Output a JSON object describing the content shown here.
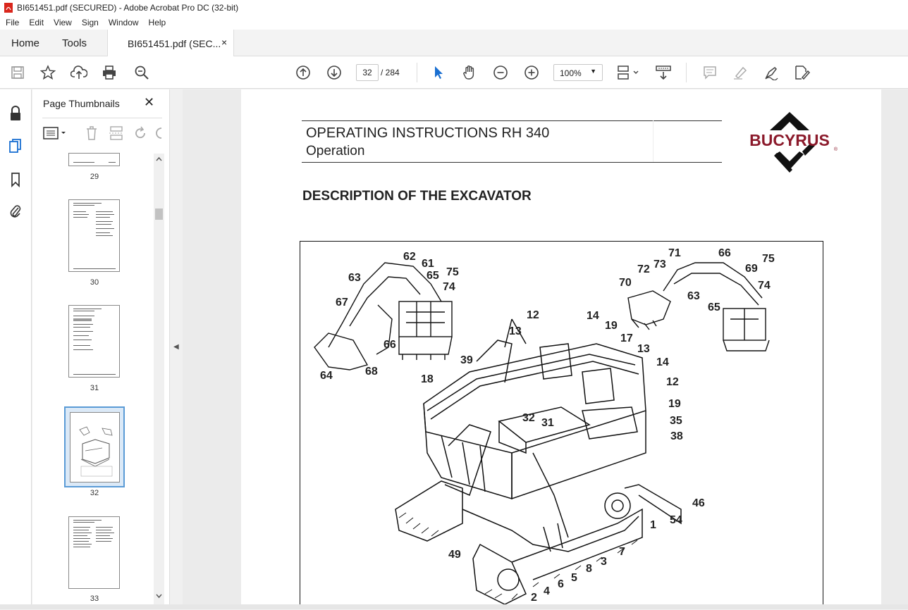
{
  "window": {
    "title": "BI651451.pdf (SECURED) - Adobe Acrobat Pro DC (32-bit)"
  },
  "menu": {
    "items": [
      "File",
      "Edit",
      "View",
      "Sign",
      "Window",
      "Help"
    ]
  },
  "tabs": {
    "home": "Home",
    "tools": "Tools",
    "document": "BI651451.pdf (SEC...",
    "close": "×"
  },
  "toolbar": {
    "current_page": "32",
    "total_pages": "/ 284",
    "zoom": "100%",
    "icons": [
      "save-icon",
      "star-icon",
      "upload-icon",
      "print-icon",
      "zoom-search-icon",
      "page-up-icon",
      "page-down-icon",
      "select-cursor-icon",
      "hand-icon",
      "zoom-out-icon",
      "zoom-in-icon",
      "page-layout-icon",
      "scroll-mode-icon",
      "comment-icon",
      "highlight-icon",
      "sign-icon",
      "fill-sign-icon"
    ]
  },
  "panel": {
    "title": "Page Thumbnails",
    "close": "✕",
    "thumbnails": [
      {
        "label": "29"
      },
      {
        "label": "30"
      },
      {
        "label": "31"
      },
      {
        "label": "32",
        "selected": true
      },
      {
        "label": "33"
      }
    ]
  },
  "document": {
    "header_title": "OPERATING INSTRUCTIONS RH 340",
    "header_subtitle": "Operation",
    "brand": "BUCYRUS",
    "brand_mark": "®",
    "section_title": "DESCRIPTION OF THE EXCAVATOR",
    "callouts": [
      "62",
      "61",
      "63",
      "65",
      "75",
      "74",
      "67",
      "66",
      "64",
      "68",
      "71",
      "66",
      "72",
      "73",
      "69",
      "75",
      "70",
      "63",
      "74",
      "65",
      "12",
      "14",
      "13",
      "19",
      "17",
      "13",
      "39",
      "14",
      "18",
      "12",
      "19",
      "32",
      "31",
      "35",
      "38",
      "46",
      "1",
      "54",
      "7",
      "3",
      "49",
      "8",
      "5",
      "6",
      "4",
      "2"
    ]
  },
  "colors": {
    "accent": "#1a6fd1",
    "brand": "#8b1a2b",
    "selection": "#5a9bd6"
  }
}
